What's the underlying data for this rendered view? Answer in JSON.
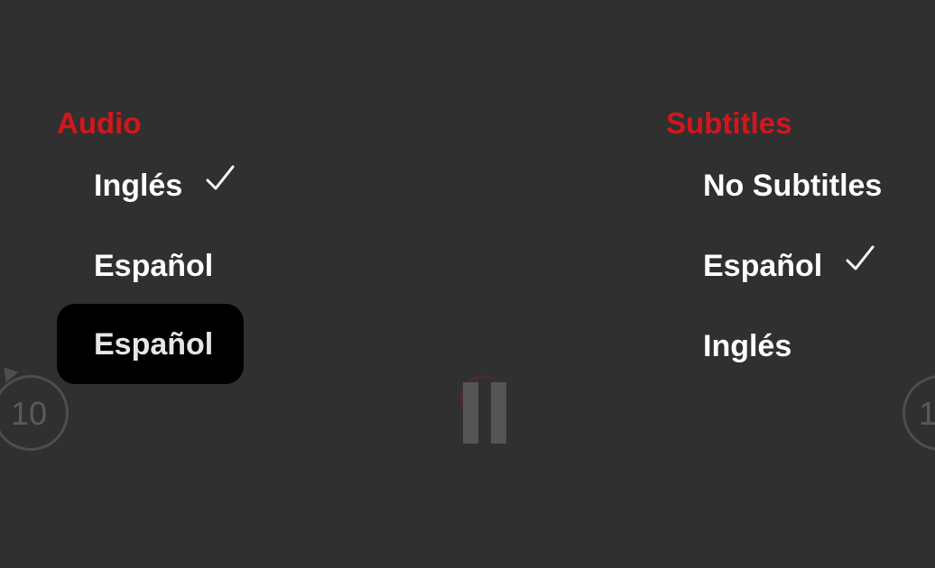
{
  "player": {
    "rewind_label": "10",
    "forward_label": "1"
  },
  "audio": {
    "title": "Audio",
    "options": [
      {
        "label": "Inglés",
        "selected": true
      },
      {
        "label": "Español",
        "selected": false
      },
      {
        "label": "Español",
        "selected": false,
        "focused": true
      }
    ]
  },
  "subtitles": {
    "title": "Subtitles",
    "options": [
      {
        "label": "No Subtitles",
        "selected": false
      },
      {
        "label": "Español",
        "selected": true
      },
      {
        "label": "Inglés",
        "selected": false
      }
    ]
  },
  "colors": {
    "background": "#303030",
    "accent": "#d3161d",
    "focus_background": "#000000",
    "text": "#ffffff"
  },
  "icons": {
    "selected": "checkmark-icon",
    "rewind": "rewind-10-icon",
    "pause": "pause-icon",
    "forward": "forward-icon"
  }
}
